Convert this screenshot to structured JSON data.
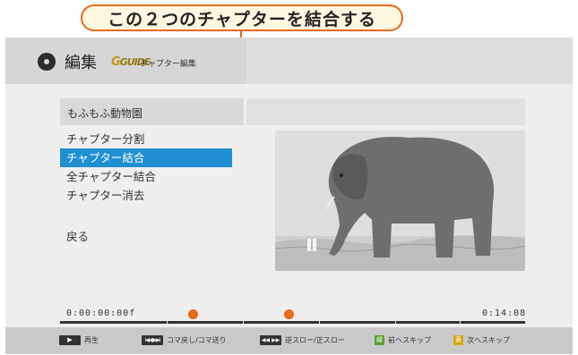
{
  "annotation": {
    "text": "この２つのチャプターを結合する"
  },
  "header": {
    "title": "編集",
    "guide_logo": "GUIDE",
    "subtitle": "チャプター編集"
  },
  "program": {
    "title": "もふもふ動物園"
  },
  "menu": {
    "items": [
      {
        "label": "チャプター分割",
        "selected": false
      },
      {
        "label": "チャプター結合",
        "selected": true
      },
      {
        "label": "全チャプター結合",
        "selected": false
      },
      {
        "label": "チャプター消去",
        "selected": false
      }
    ],
    "back_label": "戻る"
  },
  "timeline": {
    "start": "0:00:00:00f",
    "end": "0:14:08"
  },
  "footer": {
    "items": [
      {
        "key": "▶",
        "label": "再生"
      },
      {
        "key": "I◀◀ ▶▶I",
        "label": "コマ戻し/コマ送り"
      },
      {
        "key": "◀◀ ▶▶",
        "label": "逆スロー/正スロー"
      },
      {
        "key": "緑",
        "label": "前へスキップ"
      },
      {
        "key": "黄",
        "label": "次へスキップ"
      }
    ]
  },
  "colors": {
    "accent": "#e56a1c",
    "selection": "#1f8fd2"
  },
  "icons": [
    "disc-icon",
    "play-key-icon",
    "frame-step-key-icon",
    "slow-key-icon",
    "green-key-icon",
    "yellow-key-icon"
  ]
}
